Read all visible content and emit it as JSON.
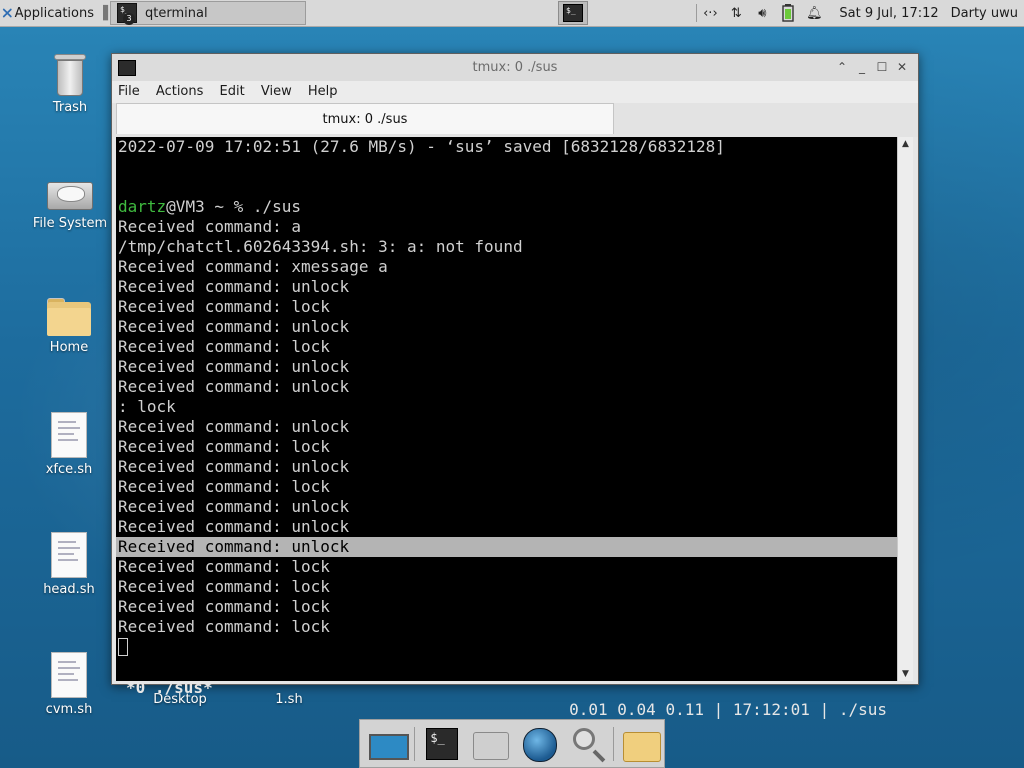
{
  "panel": {
    "applications_label": "Applications",
    "task_label": "qterminal",
    "task_badge": "3",
    "clock": "Sat  9 Jul, 17:12",
    "user": "Darty uwu"
  },
  "desktop": {
    "icons": [
      {
        "label": "Trash"
      },
      {
        "label": "File System"
      },
      {
        "label": "Home"
      },
      {
        "label": "xfce.sh"
      },
      {
        "label": "head.sh"
      },
      {
        "label": "cvm.sh"
      },
      {
        "label": "Desktop"
      },
      {
        "label": "1.sh"
      }
    ]
  },
  "window": {
    "title": "tmux: 0 ./sus",
    "menu": [
      "File",
      "Actions",
      "Edit",
      "View",
      "Help"
    ],
    "tab_label": "tmux: 0 ./sus"
  },
  "terminal": {
    "lines": [
      "2022-07-09 17:02:51 (27.6 MB/s) - ‘sus’ saved [6832128/6832128]",
      "",
      "",
      "",
      "Received command: a",
      "/tmp/chatctl.602643394.sh: 3: a: not found",
      "Received command: xmessage a",
      "Received command: unlock",
      "Received command: lock",
      "Received command: unlock",
      "Received command: lock",
      "Received command: unlock",
      "Received command: unlock",
      ": lock",
      "Received command: unlock",
      "Received command: lock",
      "Received command: unlock",
      "Received command: lock",
      "Received command: unlock",
      "Received command: unlock",
      "Received command: unlock",
      "Received command: lock",
      "Received command: lock",
      "Received command: lock",
      "Received command: lock"
    ],
    "prompt_user": "dartz",
    "prompt_rest": "@VM3 ~ % ./sus",
    "status_left": "*0 ./sus*",
    "status_right": "0.01 0.04 0.11 | 17:12:01 | ./sus"
  },
  "colors": {
    "prompt_green": "#3fba3f",
    "highlight": "#b4b4b4"
  }
}
